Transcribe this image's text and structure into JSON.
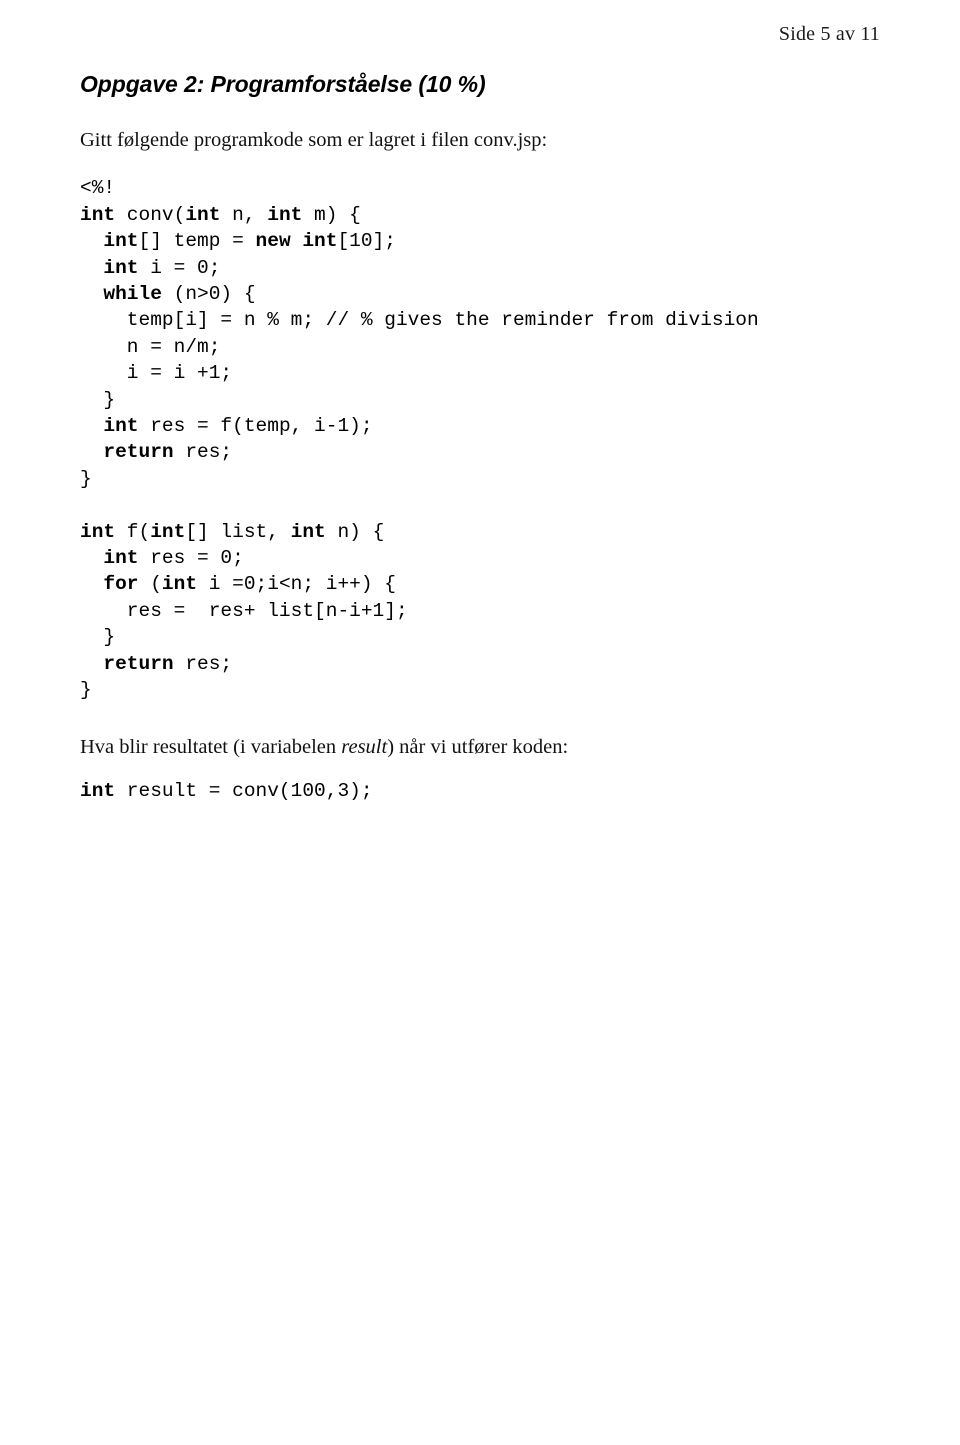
{
  "header": {
    "page_label": "Side 5 av 11"
  },
  "task": {
    "title": "Oppgave 2: Programforståelse (10 %)",
    "intro": "Gitt følgende programkode som er lagret i filen conv.jsp:",
    "question_before": "Hva blir resultatet (i variabelen ",
    "question_italic": "result",
    "question_after": ") når vi utfører koden:"
  },
  "code": {
    "lines": [
      [
        {
          "t": "<%!",
          "b": false
        }
      ],
      [
        {
          "t": "int",
          "b": true
        },
        {
          "t": " conv(",
          "b": false
        },
        {
          "t": "int",
          "b": true
        },
        {
          "t": " n, ",
          "b": false
        },
        {
          "t": "int",
          "b": true
        },
        {
          "t": " m) {",
          "b": false
        }
      ],
      [
        {
          "t": "  ",
          "b": false
        },
        {
          "t": "int",
          "b": true
        },
        {
          "t": "[] temp = ",
          "b": false
        },
        {
          "t": "new int",
          "b": true
        },
        {
          "t": "[10];",
          "b": false
        }
      ],
      [
        {
          "t": "  ",
          "b": false
        },
        {
          "t": "int",
          "b": true
        },
        {
          "t": " i = 0;",
          "b": false
        }
      ],
      [
        {
          "t": "  ",
          "b": false
        },
        {
          "t": "while",
          "b": true
        },
        {
          "t": " (n>0) {",
          "b": false
        }
      ],
      [
        {
          "t": "    temp[i] = n % m; // % gives the reminder from division",
          "b": false
        }
      ],
      [
        {
          "t": "    n = n/m;",
          "b": false
        }
      ],
      [
        {
          "t": "    i = i +1;",
          "b": false
        }
      ],
      [
        {
          "t": "  }",
          "b": false
        }
      ],
      [
        {
          "t": "  ",
          "b": false
        },
        {
          "t": "int",
          "b": true
        },
        {
          "t": " res = f(temp, i-1);",
          "b": false
        }
      ],
      [
        {
          "t": "  ",
          "b": false
        },
        {
          "t": "return",
          "b": true
        },
        {
          "t": " res;",
          "b": false
        }
      ],
      [
        {
          "t": "}",
          "b": false
        }
      ],
      [],
      [
        {
          "t": "int",
          "b": true
        },
        {
          "t": " f(",
          "b": false
        },
        {
          "t": "int",
          "b": true
        },
        {
          "t": "[] list, ",
          "b": false
        },
        {
          "t": "int",
          "b": true
        },
        {
          "t": " n) {",
          "b": false
        }
      ],
      [
        {
          "t": "  ",
          "b": false
        },
        {
          "t": "int",
          "b": true
        },
        {
          "t": " res = 0;",
          "b": false
        }
      ],
      [
        {
          "t": "  ",
          "b": false
        },
        {
          "t": "for",
          "b": true
        },
        {
          "t": " (",
          "b": false
        },
        {
          "t": "int",
          "b": true
        },
        {
          "t": " i =0;i<n; i++) {",
          "b": false
        }
      ],
      [
        {
          "t": "    res =  res+ list[n-i+1];",
          "b": false
        }
      ],
      [
        {
          "t": "  }",
          "b": false
        }
      ],
      [
        {
          "t": "  ",
          "b": false
        },
        {
          "t": "return",
          "b": true
        },
        {
          "t": " res;",
          "b": false
        }
      ],
      [
        {
          "t": "}",
          "b": false
        }
      ]
    ]
  },
  "final_code": {
    "lines": [
      [
        {
          "t": "int",
          "b": true
        },
        {
          "t": " result = conv(100,3);",
          "b": false
        }
      ]
    ]
  }
}
